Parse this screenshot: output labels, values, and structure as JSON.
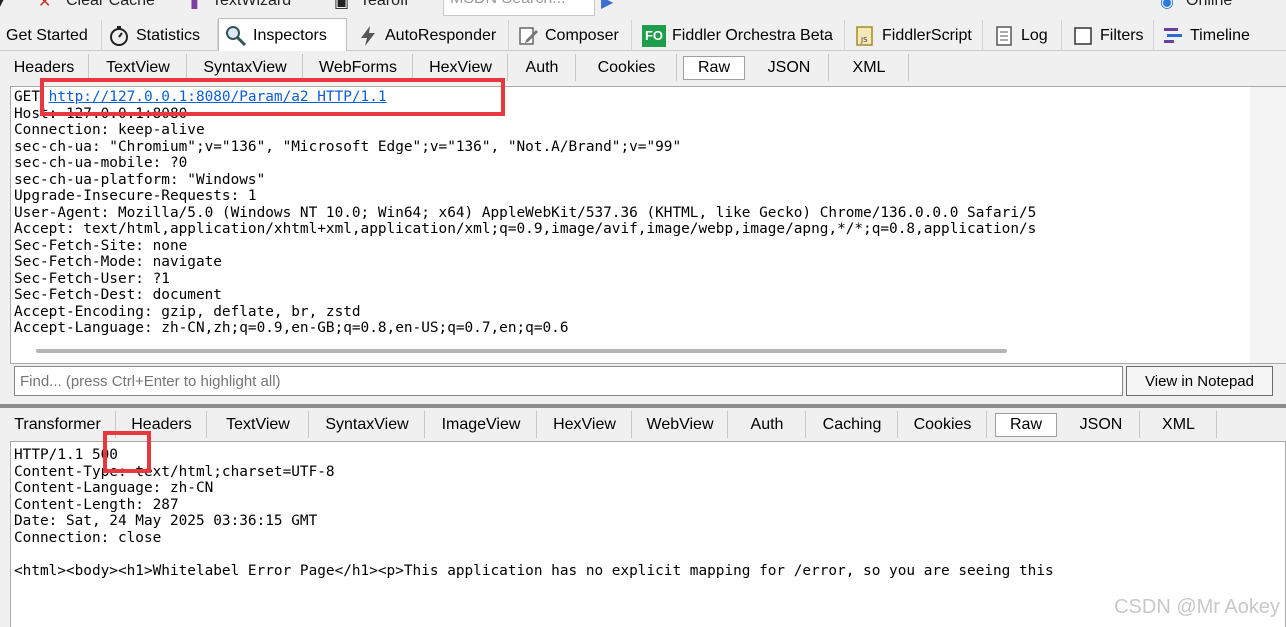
{
  "top_toolbar": {
    "clear_cache": "Clear Cache",
    "textwizard": "TextWizard",
    "tearoff": "Tearoff",
    "msdn_search": "MSDN Search...",
    "online": "Online"
  },
  "main_tabs": [
    {
      "label": "Get Started",
      "icon": ""
    },
    {
      "label": "Statistics",
      "icon": "stopwatch-icon"
    },
    {
      "label": "Inspectors",
      "icon": "magnifier-icon"
    },
    {
      "label": "AutoResponder",
      "icon": "lightning-icon"
    },
    {
      "label": "Composer",
      "icon": "pencil-icon"
    },
    {
      "label": "Fiddler Orchestra Beta",
      "icon": "fo-icon",
      "icon_text": "FO"
    },
    {
      "label": "FiddlerScript",
      "icon": "js-icon"
    },
    {
      "label": "Log",
      "icon": "log-icon"
    },
    {
      "label": "Filters",
      "icon": "checkbox-icon"
    },
    {
      "label": "Timeline",
      "icon": "timeline-icon"
    }
  ],
  "request_tabs": [
    "Headers",
    "TextView",
    "SyntaxView",
    "WebForms",
    "HexView",
    "Auth",
    "Cookies",
    "Raw",
    "JSON",
    "XML"
  ],
  "request_active": "Raw",
  "request": {
    "method": "GET ",
    "url": "http://127.0.0.1:8080/Param/a2 HTTP/1.1",
    "lines": [
      "Host: 127.0.0.1:8080",
      "Connection: keep-alive",
      "sec-ch-ua: \"Chromium\";v=\"136\", \"Microsoft Edge\";v=\"136\", \"Not.A/Brand\";v=\"99\"",
      "sec-ch-ua-mobile: ?0",
      "sec-ch-ua-platform: \"Windows\"",
      "Upgrade-Insecure-Requests: 1",
      "User-Agent: Mozilla/5.0 (Windows NT 10.0; Win64; x64) AppleWebKit/537.36 (KHTML, like Gecko) Chrome/136.0.0.0 Safari/5",
      "Accept: text/html,application/xhtml+xml,application/xml;q=0.9,image/avif,image/webp,image/apng,*/*;q=0.8,application/s",
      "Sec-Fetch-Site: none",
      "Sec-Fetch-Mode: navigate",
      "Sec-Fetch-User: ?1",
      "Sec-Fetch-Dest: document",
      "Accept-Encoding: gzip, deflate, br, zstd",
      "Accept-Language: zh-CN,zh;q=0.9,en-GB;q=0.8,en-US;q=0.7,en;q=0.6"
    ]
  },
  "find": {
    "placeholder": "Find... (press Ctrl+Enter to highlight all)",
    "notepad_label": "View in Notepad"
  },
  "response_tabs": [
    "Transformer",
    "Headers",
    "TextView",
    "SyntaxView",
    "ImageView",
    "HexView",
    "WebView",
    "Auth",
    "Caching",
    "Cookies",
    "Raw",
    "JSON",
    "XML"
  ],
  "response_active": "Raw",
  "response": {
    "status_prefix": "HTTP/1.1 ",
    "status_code": "500",
    "lines": [
      "Content-Type: text/html;charset=UTF-8",
      "Content-Language: zh-CN",
      "Content-Length: 287",
      "Date: Sat, 24 May 2025 03:36:15 GMT",
      "Connection: close",
      "",
      "<html><body><h1>Whitelabel Error Page</h1><p>This application has no explicit mapping for /error, so you are seeing this"
    ]
  },
  "watermark": "CSDN @Mr  Aokey",
  "colors": {
    "highlight": "#e8383f",
    "link": "#0b5ed7",
    "fo_badge": "#1e9e4a"
  }
}
